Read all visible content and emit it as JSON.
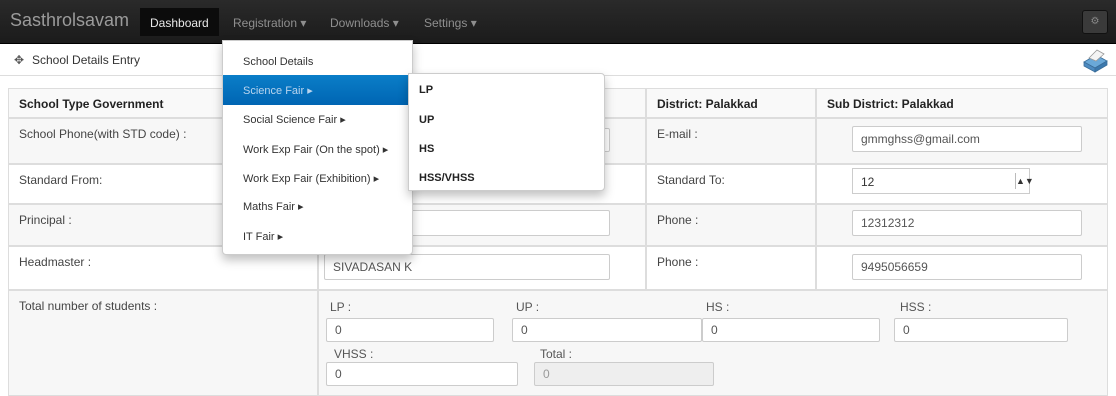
{
  "navbar": {
    "brand": "Sasthrolsavam",
    "items": [
      {
        "label": "Dashboard"
      },
      {
        "label": "Registration ▾"
      },
      {
        "label": "Downloads ▾"
      },
      {
        "label": "Settings ▾"
      }
    ]
  },
  "subheader": {
    "title": "School Details Entry",
    "icon": "move-icon"
  },
  "registration_menu": {
    "items": [
      {
        "label": "School Details"
      },
      {
        "label": "Science Fair ▸"
      },
      {
        "label": "Social Science Fair ▸"
      },
      {
        "label": "Work Exp Fair (On the spot) ▸"
      },
      {
        "label": "Work Exp Fair (Exhibition) ▸"
      },
      {
        "label": "Maths Fair ▸"
      },
      {
        "label": "IT Fair ▸"
      }
    ],
    "active_index": 1
  },
  "science_fair_submenu": {
    "items": [
      {
        "label": "LP"
      },
      {
        "label": "UP"
      },
      {
        "label": "HS"
      },
      {
        "label": "HSS/VHSS"
      }
    ]
  },
  "form": {
    "school_type": "School Type Government",
    "district": "District: Palakkad",
    "sub_district": "Sub District: Palakkad",
    "school_phone_label": "School Phone(with STD code) :",
    "email_label": "E-mail :",
    "email_value": "gmmghss@gmail.com",
    "standard_from_label": "Standard From:",
    "standard_to_label": "Standard To:",
    "standard_to_value": "12",
    "principal_label": "Principal :",
    "principal_phone_label": "Phone :",
    "principal_phone_value": "12312312",
    "headmaster_label": "Headmaster :",
    "headmaster_value": "SIVADASAN K",
    "headmaster_phone_label": "Phone :",
    "headmaster_phone_value": "9495056659",
    "total_students_label": "Total number of students :",
    "lp_label": "LP :",
    "lp_value": "0",
    "up_label": "UP :",
    "up_value": "0",
    "hs_label": "HS :",
    "hs_value": "0",
    "hss_label": "HSS :",
    "hss_value": "0",
    "vhss_label": "VHSS :",
    "vhss_value": "0",
    "total_label": "Total :",
    "total_value": "0"
  },
  "colors": {
    "navbar_bg": "#1b1b1b",
    "menu_active": "#0a7ec8"
  }
}
